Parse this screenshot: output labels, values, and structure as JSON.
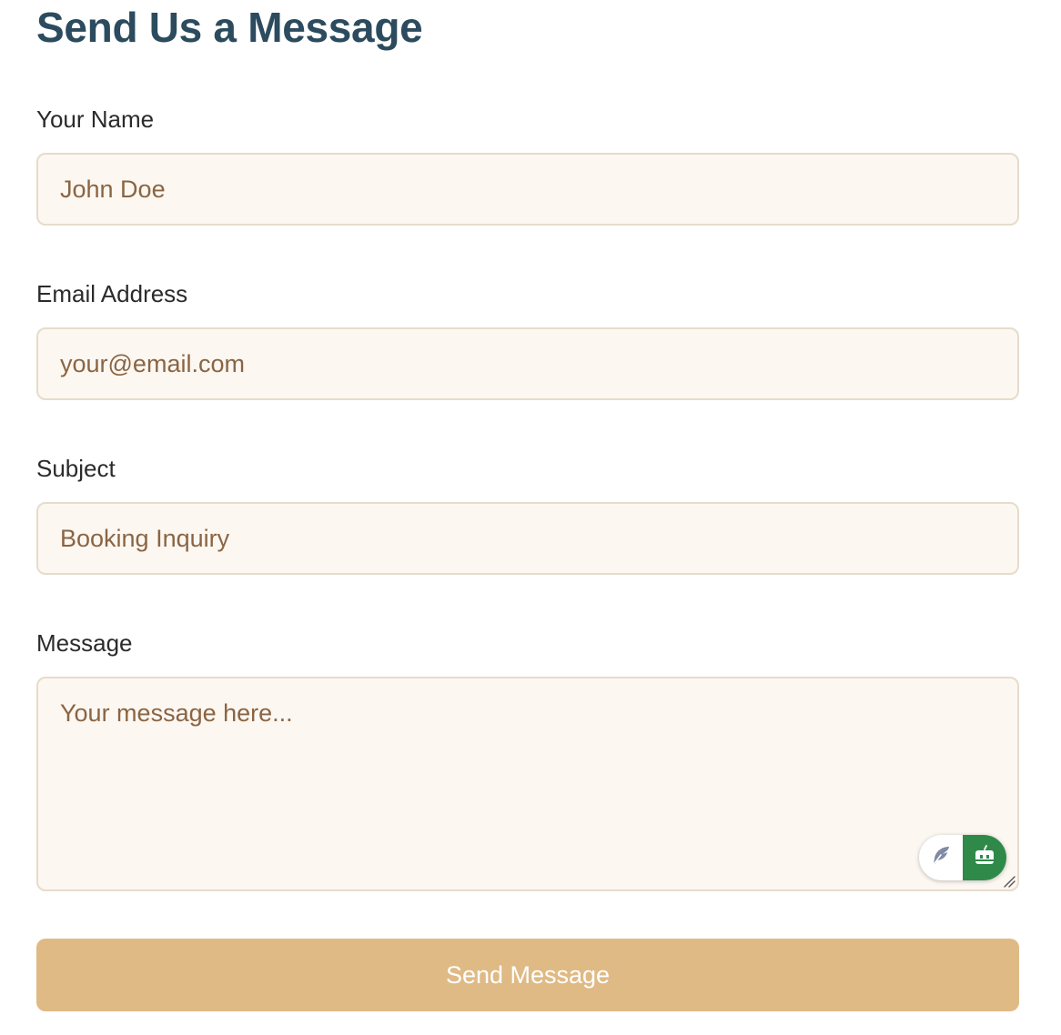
{
  "form": {
    "title": "Send Us a Message",
    "name": {
      "label": "Your Name",
      "placeholder": "John Doe"
    },
    "email": {
      "label": "Email Address",
      "placeholder": "your@email.com"
    },
    "subject": {
      "label": "Subject",
      "placeholder": "Booking Inquiry"
    },
    "message": {
      "label": "Message",
      "placeholder": "Your message here..."
    },
    "submit_label": "Send Message"
  },
  "writing_widget": {
    "left_icon": "feather-icon",
    "right_icon": "robot-icon",
    "accent": "#2f8a4a"
  },
  "colors": {
    "title": "#2c4b5e",
    "input_background": "#fcf7f1",
    "input_border": "#e6dccb",
    "placeholder": "#8a6543",
    "button": "#dfba85"
  }
}
